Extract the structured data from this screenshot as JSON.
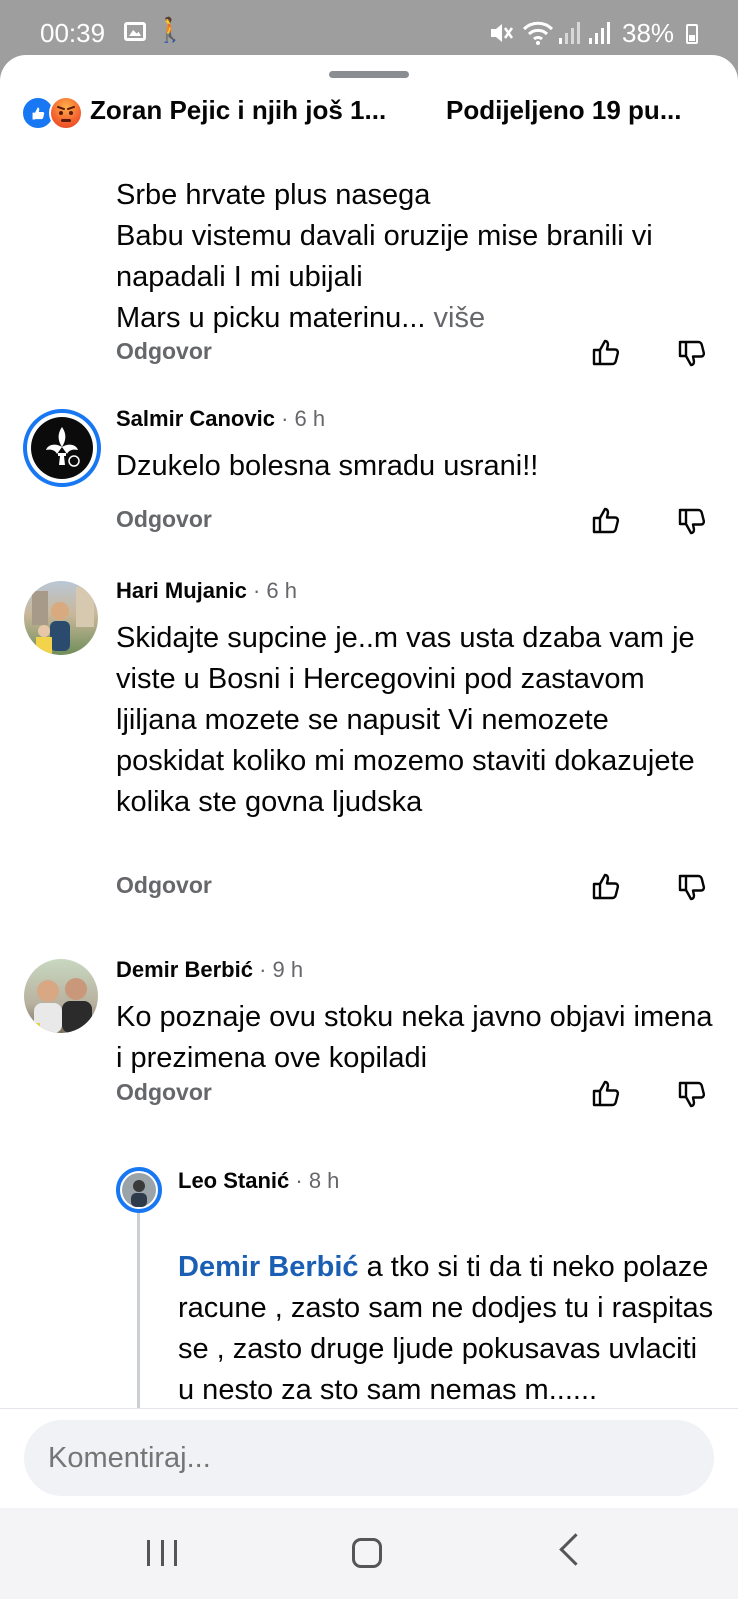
{
  "status_bar": {
    "time": "00:39",
    "battery": "38%"
  },
  "header": {
    "reactors": "Zoran Pejic i njih još 1...",
    "shares": "Podijeljeno 19 pu..."
  },
  "colors": {
    "link": "#1877f2",
    "muted": "#65676b",
    "text": "#050505"
  },
  "comments": [
    {
      "text": "Srbe hrvate plus nasega\nBabu vistemu davali oruzije mise branili vi napadali I mi ubijali\nMars u picku materinu...",
      "more": "više",
      "reply_label": "Odgovor"
    },
    {
      "author": "Salmir Canovic",
      "time": "· 6 h",
      "text": "Dzukelo bolesna smradu usrani!!",
      "reply_label": "Odgovor"
    },
    {
      "author": "Hari Mujanic",
      "time": "· 6 h",
      "text": "Skidajte supcine je..m vas usta dzaba vam je viste u Bosni i Hercegovini pod zastavom ljiljana mozete se napusit Vi nemozete poskidat koliko mi mozemo staviti dokazujete kolika ste govna ljudska",
      "reply_label": "Odgovor"
    },
    {
      "author": "Demir Berbić",
      "time": "· 9 h",
      "text": "Ko poznaje ovu stoku neka javno objavi imena i prezimena ove kopiladi",
      "reply_label": "Odgovor"
    }
  ],
  "reply": {
    "author": "Leo Stanić",
    "time": "· 8 h",
    "mention": "Demir Berbić",
    "text": " a tko si ti da ti neko polaze racune , zasto sam ne dodjes tu i raspitas se , zasto druge ljude pokusavas uvlaciti u nesto za sto sam nemas m......"
  },
  "composer": {
    "placeholder": "Komentiraj..."
  }
}
